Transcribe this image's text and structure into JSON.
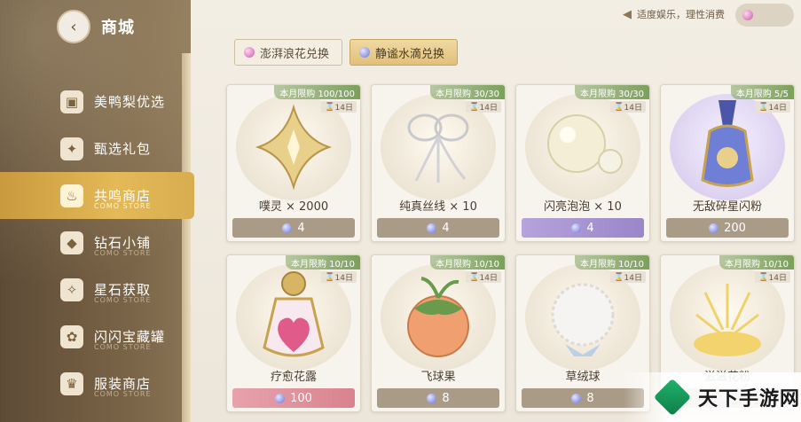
{
  "header": {
    "title": "商城",
    "notice": "适度娱乐，理性消费"
  },
  "sidebar": {
    "items": [
      {
        "label": "美鸭梨优选",
        "sub": "",
        "icon": "gift-box-icon"
      },
      {
        "label": "甄选礼包",
        "sub": "",
        "icon": "gift-icon"
      },
      {
        "label": "共鸣商店",
        "sub": "COMO STORE",
        "icon": "drop-icon",
        "active": true
      },
      {
        "label": "钻石小铺",
        "sub": "COMO STORE",
        "icon": "diamond-icon"
      },
      {
        "label": "星石获取",
        "sub": "COMO STORE",
        "icon": "star-stone-icon"
      },
      {
        "label": "闪闪宝藏罐",
        "sub": "COMO STORE",
        "icon": "treasure-jar-icon"
      },
      {
        "label": "服装商店",
        "sub": "COMO STORE",
        "icon": "clothes-icon"
      }
    ]
  },
  "tabs": [
    {
      "label": "澎湃浪花兑换",
      "gem": "pink"
    },
    {
      "label": "静谧水滴兑换",
      "gem": "blue",
      "active": true
    }
  ],
  "products": [
    {
      "name": "噗灵 × 2000",
      "limit": "本月限购 100/100",
      "timer": "14日",
      "price": "4",
      "price_style": "gray",
      "art": "gold-star"
    },
    {
      "name": "纯真丝线 × 10",
      "limit": "本月限购 30/30",
      "timer": "14日",
      "price": "4",
      "price_style": "gray",
      "art": "silk"
    },
    {
      "name": "闪亮泡泡 × 10",
      "limit": "本月限购 30/30",
      "timer": "14日",
      "price": "4",
      "price_style": "purple",
      "art": "bubble"
    },
    {
      "name": "无敌碎星闪粉",
      "limit": "本月限购 5/5",
      "timer": "14日",
      "price": "200",
      "price_style": "gray",
      "art": "bottle"
    },
    {
      "name": "疗愈花露",
      "limit": "本月限购 10/10",
      "timer": "14日",
      "price": "100",
      "price_style": "pink",
      "art": "heart-bottle"
    },
    {
      "name": "飞球果",
      "limit": "本月限购 10/10",
      "timer": "14日",
      "price": "8",
      "price_style": "gray",
      "art": "fruit"
    },
    {
      "name": "草绒球",
      "limit": "本月限购 10/10",
      "timer": "14日",
      "price": "8",
      "price_style": "gray",
      "art": "fluff"
    },
    {
      "name": "滋滋花粉",
      "limit": "本月限购 10/10",
      "timer": "14日",
      "price": "",
      "price_style": "gray",
      "art": "pollen"
    }
  ],
  "watermark": {
    "text": "天下手游网"
  },
  "colors": {
    "accent": "#e4b957",
    "limit_badge": "#7aa05a"
  }
}
